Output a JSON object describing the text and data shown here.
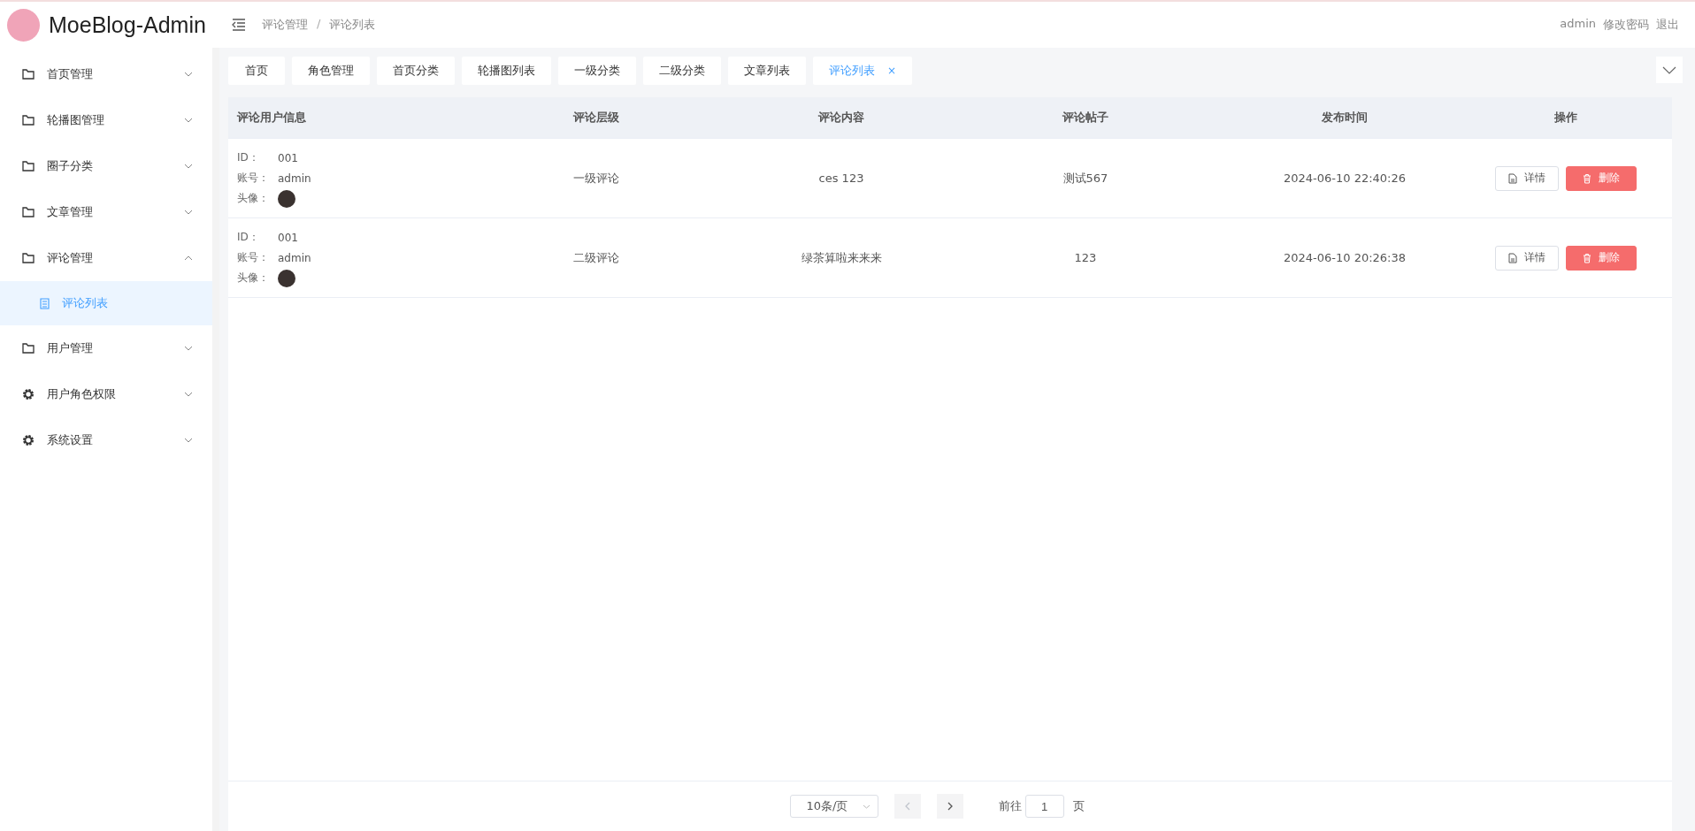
{
  "header": {
    "title": "MoeBlog-Admin",
    "breadcrumb": [
      "评论管理",
      "评论列表"
    ],
    "breadcrumb_separator": "/",
    "user": "admin",
    "links": [
      "修改密码",
      "退出"
    ]
  },
  "sidebar": {
    "items": [
      {
        "kind": "folder",
        "label": "首页管理",
        "expanded": false
      },
      {
        "kind": "folder",
        "label": "轮播图管理",
        "expanded": false
      },
      {
        "kind": "folder",
        "label": "圈子分类",
        "expanded": false
      },
      {
        "kind": "folder",
        "label": "文章管理",
        "expanded": false
      },
      {
        "kind": "folder",
        "label": "评论管理",
        "expanded": true,
        "children": [
          {
            "label": "评论列表",
            "selected": true
          }
        ]
      },
      {
        "kind": "folder",
        "label": "用户管理",
        "expanded": false
      },
      {
        "kind": "gear",
        "label": "用户角色权限",
        "expanded": false
      },
      {
        "kind": "gear",
        "label": "系统设置",
        "expanded": false
      }
    ]
  },
  "tabs": [
    {
      "label": "首页",
      "selected": false
    },
    {
      "label": "角色管理",
      "selected": false
    },
    {
      "label": "首页分类",
      "selected": false
    },
    {
      "label": "轮播图列表",
      "selected": false
    },
    {
      "label": "一级分类",
      "selected": false
    },
    {
      "label": "二级分类",
      "selected": false
    },
    {
      "label": "文章列表",
      "selected": false
    },
    {
      "label": "评论列表",
      "selected": true,
      "close": "×"
    }
  ],
  "table": {
    "columns": [
      "评论用户信息",
      "评论层级",
      "评论内容",
      "评论帖子",
      "发布时间",
      "操作"
    ],
    "rows": [
      {
        "id_label": "ID：",
        "id": "001",
        "account_label": "账号：",
        "account": "admin",
        "avatar_label": "头像：",
        "level": "一级评论",
        "content": "ces 123",
        "post": "测试567",
        "time": "2024-06-10 22:40:26",
        "actions": [
          "详情",
          "删除"
        ]
      },
      {
        "id_label": "ID：",
        "id": "001",
        "account_label": "账号：",
        "account": "admin",
        "avatar_label": "头像：",
        "level": "二级评论",
        "content": "绿茶算啦来来来",
        "post": "123",
        "time": "2024-06-10 20:26:38",
        "actions": [
          "详情",
          "删除"
        ]
      }
    ]
  },
  "pagination": {
    "page_size": "10条/页",
    "prev_disabled": true,
    "next_disabled": false,
    "goto_label": "前往",
    "page": "1",
    "page_suffix": "页"
  }
}
